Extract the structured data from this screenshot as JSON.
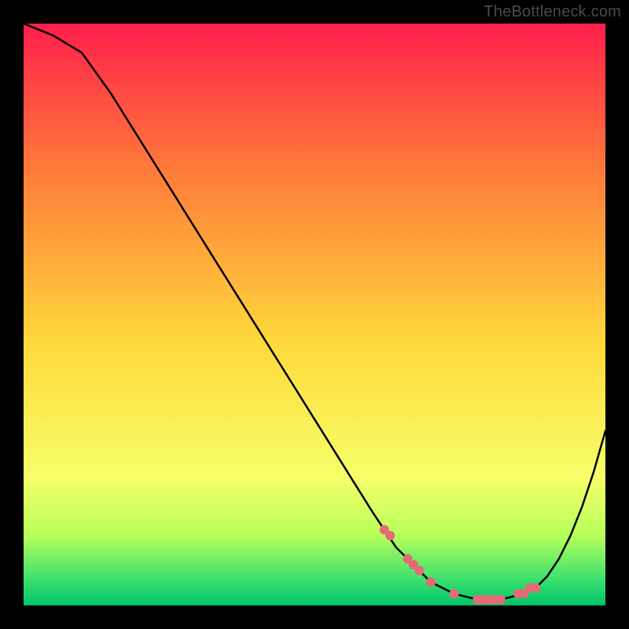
{
  "watermark": "TheBottleneck.com",
  "colors": {
    "bg": "#000000",
    "curve": "#000000",
    "marker": "#e46a76",
    "gradient_top": "#ff1f4b",
    "gradient_mid_upper": "#ff7a3a",
    "gradient_mid": "#ffd93b",
    "gradient_mid_lower": "#f6ff6a",
    "gradient_green1": "#b7ff5a",
    "gradient_green2": "#44e36e",
    "gradient_bottom": "#00c46a"
  },
  "chart_data": {
    "type": "line",
    "title": "",
    "xlabel": "",
    "ylabel": "",
    "xlim": [
      0,
      100
    ],
    "ylim": [
      0,
      100
    ],
    "x": [
      0,
      5,
      10,
      15,
      20,
      25,
      30,
      35,
      40,
      45,
      50,
      55,
      60,
      62,
      64,
      66,
      68,
      70,
      72,
      74,
      76,
      78,
      80,
      82,
      84,
      86,
      88,
      90,
      92,
      94,
      96,
      98,
      100
    ],
    "values": [
      100,
      98,
      95,
      88,
      80,
      72,
      64,
      56,
      48,
      40,
      32,
      24,
      16,
      13,
      10,
      8,
      6,
      4,
      3,
      2,
      1.5,
      1,
      1,
      1,
      1.5,
      2,
      3,
      5,
      8,
      12,
      17,
      23,
      30
    ],
    "markers_x": [
      62,
      63,
      66,
      67,
      68,
      70,
      74,
      78,
      79,
      80,
      81,
      82,
      85,
      86,
      87,
      88
    ],
    "markers_y": [
      13,
      12,
      8,
      7,
      6,
      4,
      2,
      1,
      1,
      1,
      1,
      1,
      2,
      2,
      3,
      3
    ]
  }
}
